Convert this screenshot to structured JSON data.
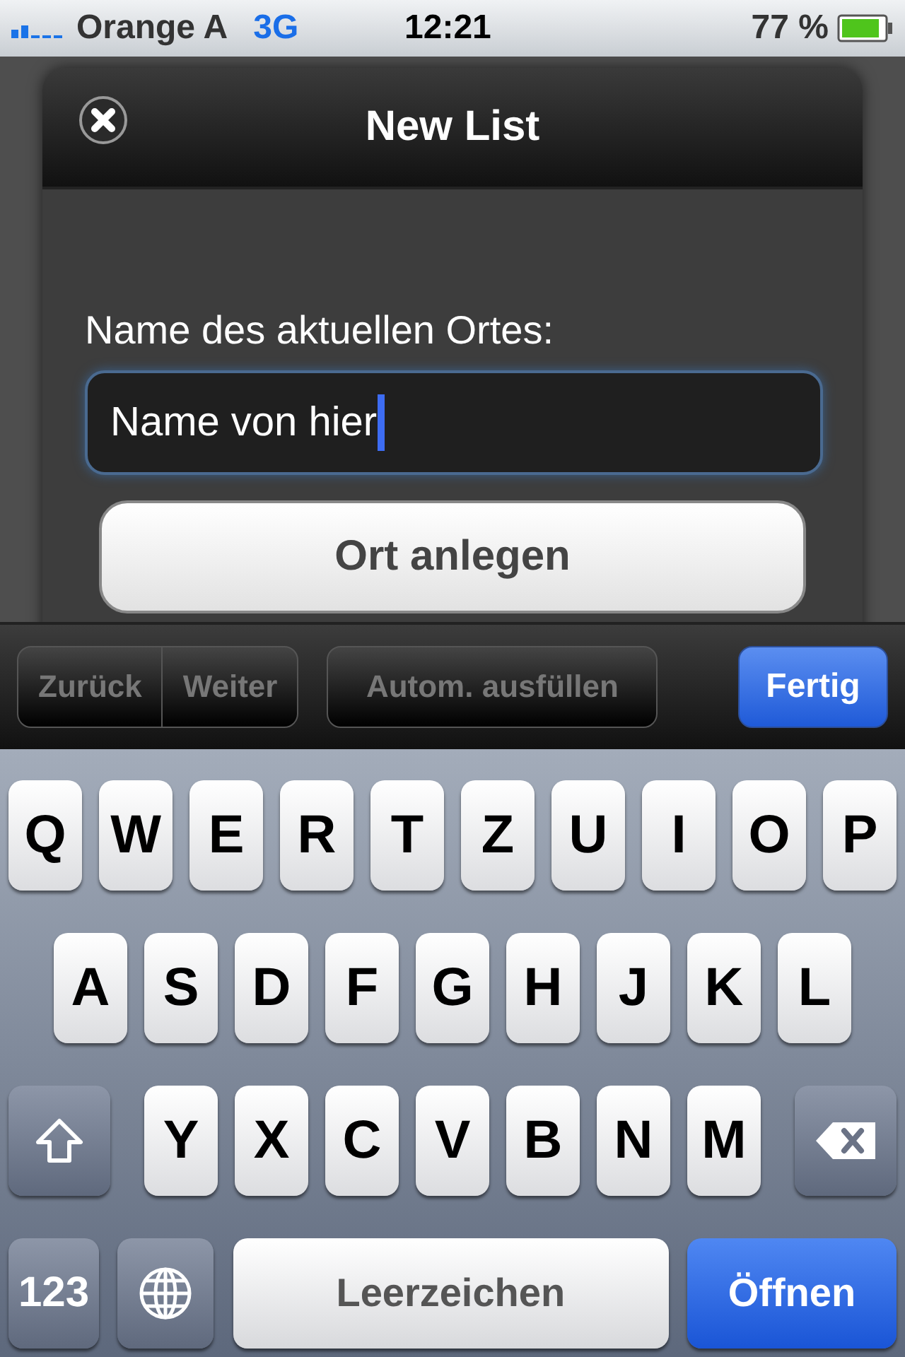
{
  "status_bar": {
    "carrier": "Orange A",
    "network": "3G",
    "time": "12:21",
    "battery": "77 %"
  },
  "dialog": {
    "title": "New List",
    "field_label": "Name des aktuellen Ortes:",
    "field_value": "Name von hier",
    "submit": "Ort anlegen"
  },
  "toolbar": {
    "segments": [
      {
        "label": "Zurück",
        "disabled": true
      },
      {
        "label": "Weiter",
        "disabled": true
      }
    ],
    "autofill": {
      "label": "Autom. ausfüllen",
      "disabled": true
    },
    "done": "Fertig"
  },
  "keyboard": {
    "rows": [
      [
        {
          "kind": "letter",
          "label": "Q"
        },
        {
          "kind": "letter",
          "label": "W"
        },
        {
          "kind": "letter",
          "label": "E"
        },
        {
          "kind": "letter",
          "label": "R"
        },
        {
          "kind": "letter",
          "label": "T"
        },
        {
          "kind": "letter",
          "label": "Z"
        },
        {
          "kind": "letter",
          "label": "U"
        },
        {
          "kind": "letter",
          "label": "I"
        },
        {
          "kind": "letter",
          "label": "O"
        },
        {
          "kind": "letter",
          "label": "P"
        }
      ],
      [
        {
          "kind": "letter",
          "label": "A"
        },
        {
          "kind": "letter",
          "label": "S"
        },
        {
          "kind": "letter",
          "label": "D"
        },
        {
          "kind": "letter",
          "label": "F"
        },
        {
          "kind": "letter",
          "label": "G"
        },
        {
          "kind": "letter",
          "label": "H"
        },
        {
          "kind": "letter",
          "label": "J"
        },
        {
          "kind": "letter",
          "label": "K"
        },
        {
          "kind": "letter",
          "label": "L"
        }
      ],
      [
        {
          "kind": "shift"
        },
        {
          "kind": "letter",
          "label": "Y"
        },
        {
          "kind": "letter",
          "label": "X"
        },
        {
          "kind": "letter",
          "label": "C"
        },
        {
          "kind": "letter",
          "label": "V"
        },
        {
          "kind": "letter",
          "label": "B"
        },
        {
          "kind": "letter",
          "label": "N"
        },
        {
          "kind": "letter",
          "label": "M"
        },
        {
          "kind": "backspace"
        }
      ]
    ],
    "bottom_bar": {
      "numbers_key": "123",
      "space_key": "Leerzeichen",
      "return_key": "Öffnen"
    }
  }
}
